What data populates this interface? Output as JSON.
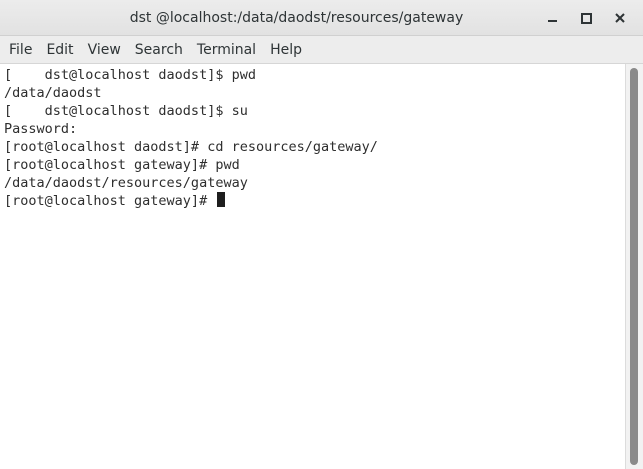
{
  "window": {
    "title": "dst @localhost:/data/daodst/resources/gateway"
  },
  "window_controls": {
    "minimize": "minimize-icon",
    "maximize": "maximize-icon",
    "close": "close-icon"
  },
  "menu": [
    {
      "label": "File"
    },
    {
      "label": "Edit"
    },
    {
      "label": "View"
    },
    {
      "label": "Search"
    },
    {
      "label": "Terminal"
    },
    {
      "label": "Help"
    }
  ],
  "terminal": {
    "lines": [
      "[    dst@localhost daodst]$ pwd",
      "/data/daodst",
      "[    dst@localhost daodst]$ su",
      "Password:",
      "[root@localhost daodst]# cd resources/gateway/",
      "[root@localhost gateway]# pwd",
      "/data/daodst/resources/gateway",
      "[root@localhost gateway]# "
    ]
  }
}
